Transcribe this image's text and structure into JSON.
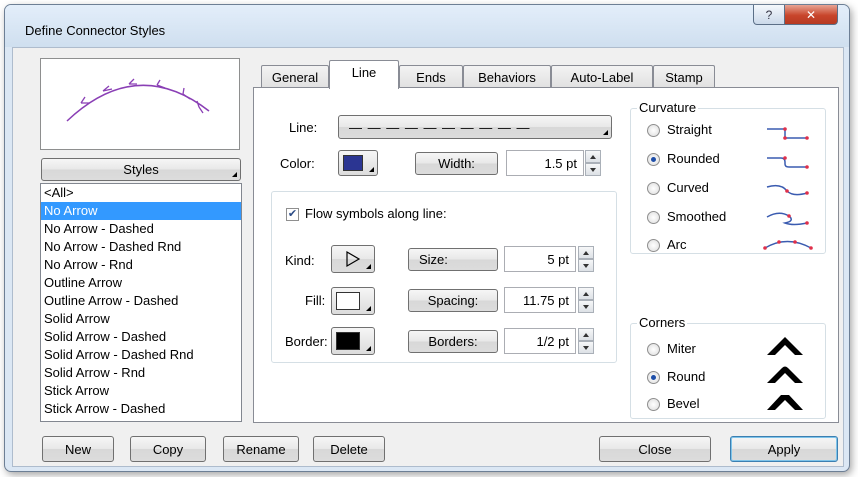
{
  "window": {
    "title": "Define Connector Styles",
    "help_label": "?",
    "close_label": "✕"
  },
  "styles_button": {
    "label": "Styles"
  },
  "styles_list": [
    {
      "label": "<All>",
      "selected": false
    },
    {
      "label": "No Arrow",
      "selected": true
    },
    {
      "label": "No Arrow - Dashed",
      "selected": false
    },
    {
      "label": "No Arrow - Dashed Rnd",
      "selected": false
    },
    {
      "label": "No Arrow - Rnd",
      "selected": false
    },
    {
      "label": "Outline Arrow",
      "selected": false
    },
    {
      "label": "Outline Arrow - Dashed",
      "selected": false
    },
    {
      "label": "Solid Arrow",
      "selected": false
    },
    {
      "label": "Solid Arrow - Dashed",
      "selected": false
    },
    {
      "label": "Solid Arrow - Dashed Rnd",
      "selected": false
    },
    {
      "label": "Solid Arrow - Rnd",
      "selected": false
    },
    {
      "label": "Stick Arrow",
      "selected": false
    },
    {
      "label": "Stick Arrow - Dashed",
      "selected": false
    }
  ],
  "tabs": [
    {
      "label": "General",
      "active": false
    },
    {
      "label": "Line",
      "active": true
    },
    {
      "label": "Ends",
      "active": false
    },
    {
      "label": "Behaviors",
      "active": false
    },
    {
      "label": "Auto-Label",
      "active": false
    },
    {
      "label": "Stamp",
      "active": false
    }
  ],
  "line_tab": {
    "line_label": "Line:",
    "line_pattern": "— — — — — — — — — —",
    "color_label": "Color:",
    "color_value": "#2b3592",
    "width_button": "Width:",
    "width_value": "1.5 pt",
    "flow": {
      "checkbox_label": "Flow symbols along line:",
      "checked": true,
      "kind_label": "Kind:",
      "size_button": "Size:",
      "size_value": "5 pt",
      "fill_label": "Fill:",
      "fill_color": "#ffffff",
      "spacing_button": "Spacing:",
      "spacing_value": "11.75 pt",
      "border_label": "Border:",
      "border_color": "#000000",
      "borders_button": "Borders:",
      "borders_value": "1/2 pt"
    },
    "curvature": {
      "title": "Curvature",
      "options": [
        {
          "label": "Straight",
          "checked": false
        },
        {
          "label": "Rounded",
          "checked": true
        },
        {
          "label": "Curved",
          "checked": false
        },
        {
          "label": "Smoothed",
          "checked": false
        },
        {
          "label": "Arc",
          "checked": false
        }
      ]
    },
    "corners": {
      "title": "Corners",
      "options": [
        {
          "label": "Miter",
          "checked": false
        },
        {
          "label": "Round",
          "checked": true
        },
        {
          "label": "Bevel",
          "checked": false
        }
      ]
    }
  },
  "footer": {
    "new": "New",
    "copy": "Copy",
    "rename": "Rename",
    "delete": "Delete",
    "close": "Close",
    "apply": "Apply"
  },
  "colors": {
    "selection": "#3399ff",
    "preview_line": "#8a3fb5",
    "marker": "#e0304a",
    "marker_line": "#3a5bb0"
  }
}
